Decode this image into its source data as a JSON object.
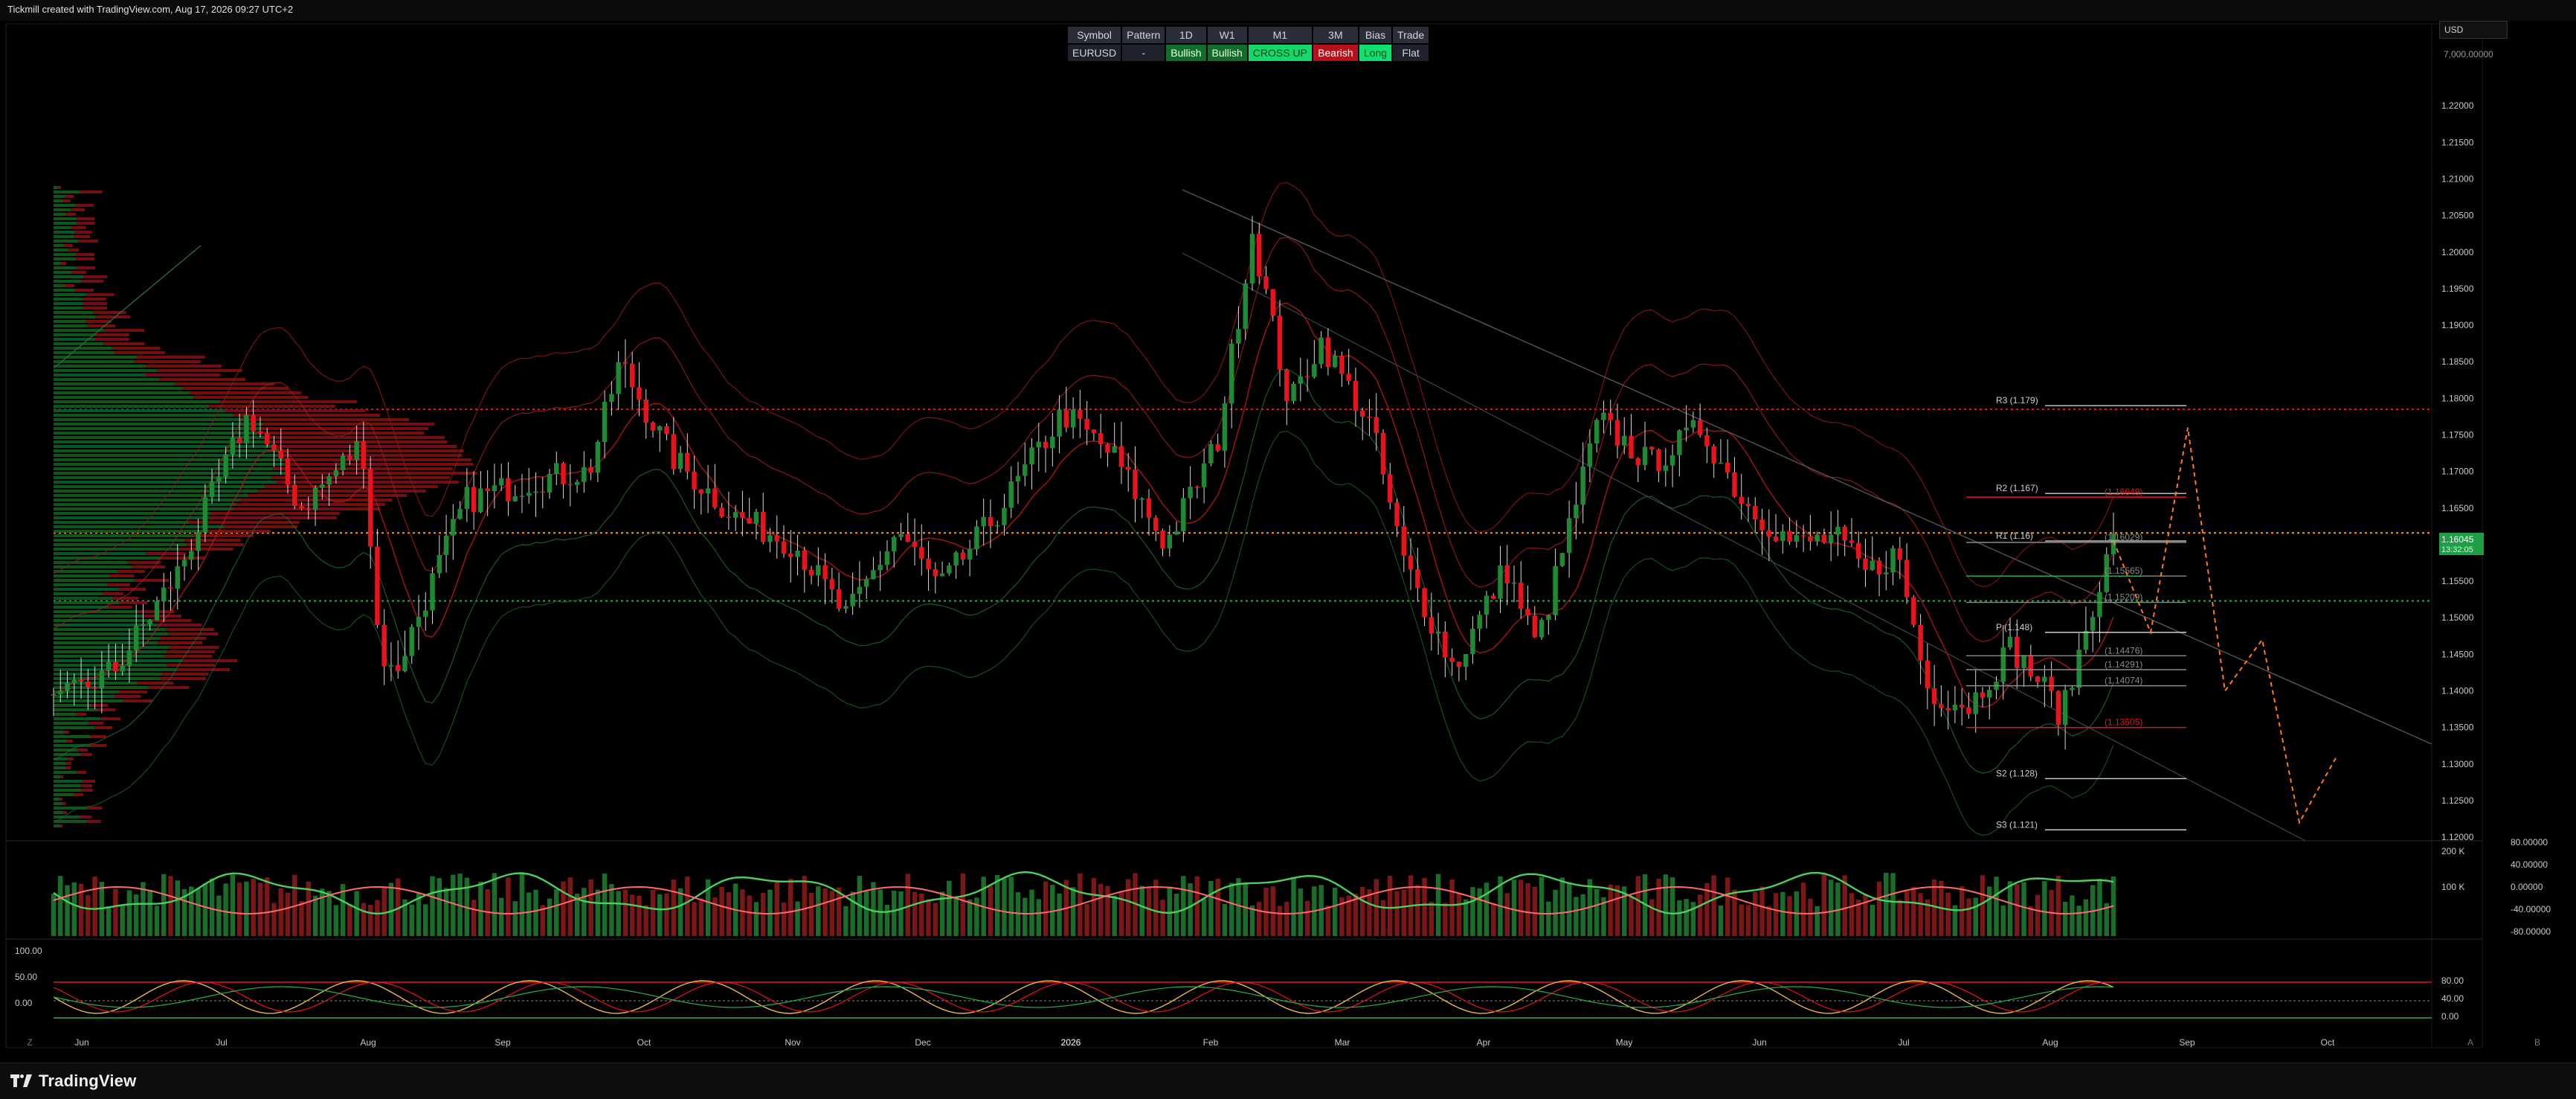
{
  "header": {
    "caption": "Tickmill created with TradingView.com, Aug 17, 2026 09:27 UTC+2"
  },
  "status_table": {
    "headers": [
      "Symbol",
      "Pattern",
      "1D",
      "W1",
      "M1",
      "3M",
      "Bias",
      "Trade"
    ],
    "values": [
      "EURUSD",
      "-",
      "Bullish",
      "Bullish",
      "CROSS UP",
      "Bearish",
      "Long",
      "Flat"
    ]
  },
  "currency": "USD",
  "capital": "7,000.00000",
  "last_price": {
    "price": "1.16045",
    "countdown": "13:32:05"
  },
  "footer": {
    "brand": "TradingView",
    "left_badge": "Z",
    "right_badges": [
      "A",
      "B"
    ]
  },
  "colors": {
    "bull": "#1e8a34",
    "bear": "#e8131b",
    "accent_green": "#14d96a",
    "badge": "#1e9e45",
    "orange": "#ff7a1a"
  },
  "chart_data": {
    "type": "candlestick",
    "symbol": "EURUSD",
    "price_axis": {
      "ticks": [
        "1.22000",
        "1.21500",
        "1.21000",
        "1.20500",
        "1.20000",
        "1.19500",
        "1.19000",
        "1.18500",
        "1.18000",
        "1.17500",
        "1.17000",
        "1.16500",
        "1.16000",
        "1.15500",
        "1.15000",
        "1.14500",
        "1.14000",
        "1.13500",
        "1.13000",
        "1.12500",
        "1.12000"
      ],
      "ylim": [
        1.1195,
        1.2245
      ]
    },
    "time_axis": {
      "labels": [
        "Jun",
        "Jul",
        "Aug",
        "Sep",
        "Oct",
        "Nov",
        "Dec",
        "2026",
        "Feb",
        "Mar",
        "Apr",
        "May",
        "Jun",
        "Jul",
        "Aug",
        "Sep",
        "Oct"
      ]
    },
    "horizontal_levels": [
      {
        "value": 1.1785,
        "style": "dotted",
        "color": "red"
      },
      {
        "value": 1.1616,
        "style": "dotted",
        "color": "orange"
      },
      {
        "value": 1.1523,
        "style": "dotted",
        "color": "green"
      }
    ],
    "pivot_levels": [
      {
        "label": "R3 (1.179)",
        "value": 1.179
      },
      {
        "label": "R2 (1.167)",
        "value": 1.167
      },
      {
        "label": "(1.16649)",
        "value": 1.1665
      },
      {
        "label": "R1 (1.16)",
        "value": 1.1605
      },
      {
        "label": "(1.16029)",
        "value": 1.1603
      },
      {
        "label": "(1.15565)",
        "value": 1.1557
      },
      {
        "label": "(1.15209)",
        "value": 1.1521
      },
      {
        "label": "P (1.148)",
        "value": 1.148
      },
      {
        "label": "(1.14476)",
        "value": 1.1448
      },
      {
        "label": "(1.14291)",
        "value": 1.1429
      },
      {
        "label": "(1.14074)",
        "value": 1.1407
      },
      {
        "label": "(1.13505)",
        "value": 1.135
      },
      {
        "label": "S2 (1.128)",
        "value": 1.128
      },
      {
        "label": "S3 (1.121)",
        "value": 1.121
      }
    ],
    "close_anchors": [
      {
        "t": 0,
        "v": 1.138
      },
      {
        "t": 0.03,
        "v": 1.143
      },
      {
        "t": 0.06,
        "v": 1.156
      },
      {
        "t": 0.095,
        "v": 1.178
      },
      {
        "t": 0.12,
        "v": 1.165
      },
      {
        "t": 0.15,
        "v": 1.174
      },
      {
        "t": 0.158,
        "v": 1.146
      },
      {
        "t": 0.165,
        "v": 1.142
      },
      {
        "t": 0.2,
        "v": 1.166
      },
      {
        "t": 0.235,
        "v": 1.169
      },
      {
        "t": 0.26,
        "v": 1.17
      },
      {
        "t": 0.275,
        "v": 1.185
      },
      {
        "t": 0.3,
        "v": 1.172
      },
      {
        "t": 0.33,
        "v": 1.164
      },
      {
        "t": 0.36,
        "v": 1.16
      },
      {
        "t": 0.385,
        "v": 1.15
      },
      {
        "t": 0.41,
        "v": 1.162
      },
      {
        "t": 0.43,
        "v": 1.154
      },
      {
        "t": 0.46,
        "v": 1.165
      },
      {
        "t": 0.49,
        "v": 1.178
      },
      {
        "t": 0.515,
        "v": 1.172
      },
      {
        "t": 0.54,
        "v": 1.16
      },
      {
        "t": 0.565,
        "v": 1.174
      },
      {
        "t": 0.582,
        "v": 1.203
      },
      {
        "t": 0.6,
        "v": 1.179
      },
      {
        "t": 0.615,
        "v": 1.188
      },
      {
        "t": 0.64,
        "v": 1.176
      },
      {
        "t": 0.655,
        "v": 1.158
      },
      {
        "t": 0.68,
        "v": 1.143
      },
      {
        "t": 0.705,
        "v": 1.157
      },
      {
        "t": 0.72,
        "v": 1.146
      },
      {
        "t": 0.75,
        "v": 1.177
      },
      {
        "t": 0.775,
        "v": 1.171
      },
      {
        "t": 0.8,
        "v": 1.176
      },
      {
        "t": 0.82,
        "v": 1.166
      },
      {
        "t": 0.845,
        "v": 1.16
      },
      {
        "t": 0.865,
        "v": 1.161
      },
      {
        "t": 0.88,
        "v": 1.156
      },
      {
        "t": 0.895,
        "v": 1.159
      },
      {
        "t": 0.91,
        "v": 1.14
      },
      {
        "t": 0.93,
        "v": 1.138
      },
      {
        "t": 0.95,
        "v": 1.146
      },
      {
        "t": 0.965,
        "v": 1.141
      },
      {
        "t": 0.975,
        "v": 1.1365
      },
      {
        "t": 0.99,
        "v": 1.152
      },
      {
        "t": 1.0,
        "v": 1.1605
      }
    ],
    "forecast_path": [
      {
        "label": "start",
        "v": 1.1605
      },
      {
        "v": 1.148
      },
      {
        "v": 1.176
      },
      {
        "v": 1.14
      },
      {
        "v": 1.147
      },
      {
        "v": 1.122
      },
      {
        "v": 1.131
      }
    ],
    "oscillator_axis": {
      "ticks": [
        "80.00000",
        "40.00000",
        "0.00000",
        "-40.00000",
        "-80.00000"
      ],
      "volume_ticks": [
        "200 K",
        "100 K"
      ]
    },
    "stoch_axis": {
      "ticks": [
        "100.00",
        "50.00",
        "0.00"
      ],
      "right_ticks": [
        "80.00",
        "40.00",
        "0.00"
      ]
    }
  }
}
